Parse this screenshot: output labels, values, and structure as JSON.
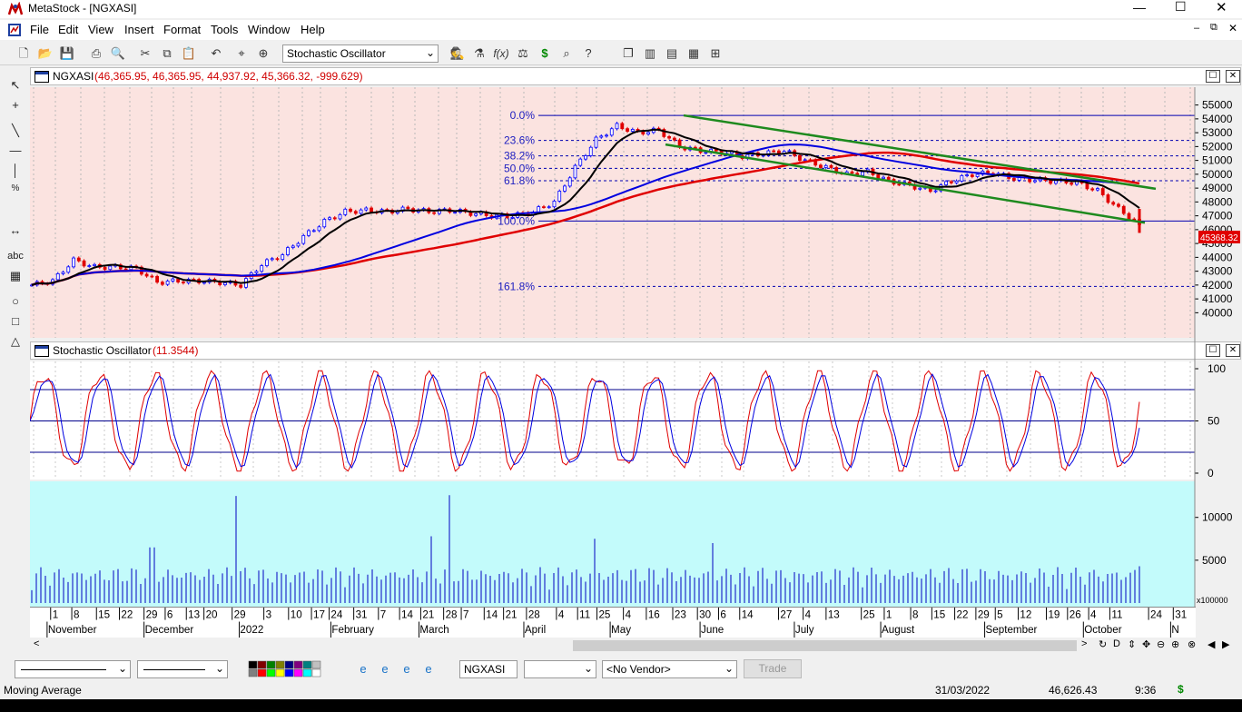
{
  "window": {
    "title": "MetaStock - [NGXASI]"
  },
  "menu": [
    "File",
    "Edit",
    "View",
    "Insert",
    "Format",
    "Tools",
    "Window",
    "Help"
  ],
  "toolbar": {
    "study_select": "Stochastic Oscillator"
  },
  "lefttools": {
    "abc": "abc"
  },
  "price_pane": {
    "title": "NGXASI",
    "ohlc": "(46,365.95, 46,365.95, 44,937.92, 45,366.32, -999.629)",
    "last_value_label": "45368.32"
  },
  "stoch_pane": {
    "title": "Stochastic Oscillator",
    "value": "(11.3544)"
  },
  "fib_labels": [
    "0.0%",
    "23.6%",
    "38.2%",
    "50.0%",
    "61.8%",
    "100.0%",
    "161.8%"
  ],
  "volume_unit": "x100000",
  "bottombar": {
    "symbol": "NGXASI",
    "vendor": "<No Vendor>",
    "trade": "Trade"
  },
  "status": {
    "left": "Moving Average",
    "date": "31/03/2022",
    "value": "46,626.43",
    "time": "9:36",
    "dollar": "$"
  },
  "colors": {
    "price_bg": "#fbe3e0",
    "stoch_bg": "#ffffff",
    "volume_bg": "#c3fbfb",
    "up": "#0000ff",
    "down": "#e00000"
  },
  "chart_data": [
    {
      "type": "line",
      "title": "NGXASI",
      "y_ticks": [
        40000,
        41000,
        42000,
        43000,
        44000,
        45000,
        46000,
        47000,
        48000,
        49000,
        50000,
        51000,
        52000,
        53000,
        54000,
        55000
      ],
      "ylim": [
        39500,
        55500
      ],
      "series": [
        {
          "name": "NGXASI",
          "values": [
            42000,
            42300,
            43800,
            43300,
            43300,
            43200,
            42200,
            42300,
            42300,
            42200,
            42000,
            43500,
            44200,
            45500,
            46600,
            47300,
            47400,
            47300,
            47500,
            47300,
            47400,
            47200,
            47000,
            47000,
            47300,
            48000,
            50500,
            52500,
            53500,
            53000,
            53200,
            52000,
            51700,
            51600,
            51300,
            51500,
            51700,
            51000,
            50500,
            50000,
            50200,
            49500,
            49200,
            48800,
            49500,
            50000,
            50100,
            49700,
            49600,
            49500,
            49400,
            48800,
            47500,
            46365
          ]
        }
      ],
      "fibonacci": {
        "levels": [
          "0.0%",
          "23.6%",
          "38.2%",
          "50.0%",
          "61.8%",
          "100.0%",
          "161.8%"
        ],
        "values": [
          54250,
          52440,
          51330,
          50430,
          49530,
          46620,
          41900
        ]
      }
    },
    {
      "type": "line",
      "title": "Stochastic Oscillator",
      "y_ticks": [
        0,
        50,
        100
      ],
      "ylim": [
        0,
        100
      ]
    },
    {
      "type": "bar",
      "title": "Volume",
      "y_ticks": [
        5000,
        10000
      ],
      "unit": "x100000",
      "x_tick_labels": [
        "1",
        "8",
        "15",
        "22",
        "29",
        "6",
        "13",
        "20",
        "29",
        "3",
        "10",
        "17",
        "24",
        "31",
        "7",
        "14",
        "21",
        "28",
        "7",
        "14",
        "21",
        "28",
        "4",
        "11",
        "25",
        "4",
        "16",
        "23",
        "30",
        "6",
        "14",
        "27",
        "4",
        "13",
        "25",
        "1",
        "8",
        "15",
        "22",
        "29",
        "5",
        "12",
        "19",
        "26",
        "4",
        "11",
        "24",
        "31"
      ],
      "month_labels": [
        "November",
        "December",
        "2022",
        "February",
        "March",
        "April",
        "May",
        "June",
        "July",
        "August",
        "September",
        "October",
        "N"
      ]
    }
  ]
}
